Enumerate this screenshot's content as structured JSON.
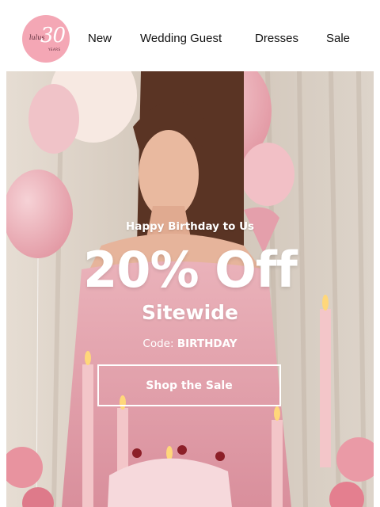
{
  "brand": {
    "logo_script": "lulus",
    "logo_number": "30",
    "logo_years": "YEARS",
    "logo_color": "#f4a7b5"
  },
  "nav": {
    "items": [
      {
        "label": "New"
      },
      {
        "label": "Wedding Guest"
      },
      {
        "label": "Dresses"
      },
      {
        "label": "Sale"
      }
    ]
  },
  "hero": {
    "eyebrow": "Happy Birthday to Us",
    "headline": "20% Off",
    "subheadline": "Sitewide",
    "code_label": "Code:",
    "code_value": "BIRTHDAY",
    "cta_label": "Shop the Sale",
    "accent_colors": {
      "dress": "#e7a3ad",
      "balloon": "#f0b8bf",
      "candle": "#f3c6c9"
    }
  }
}
